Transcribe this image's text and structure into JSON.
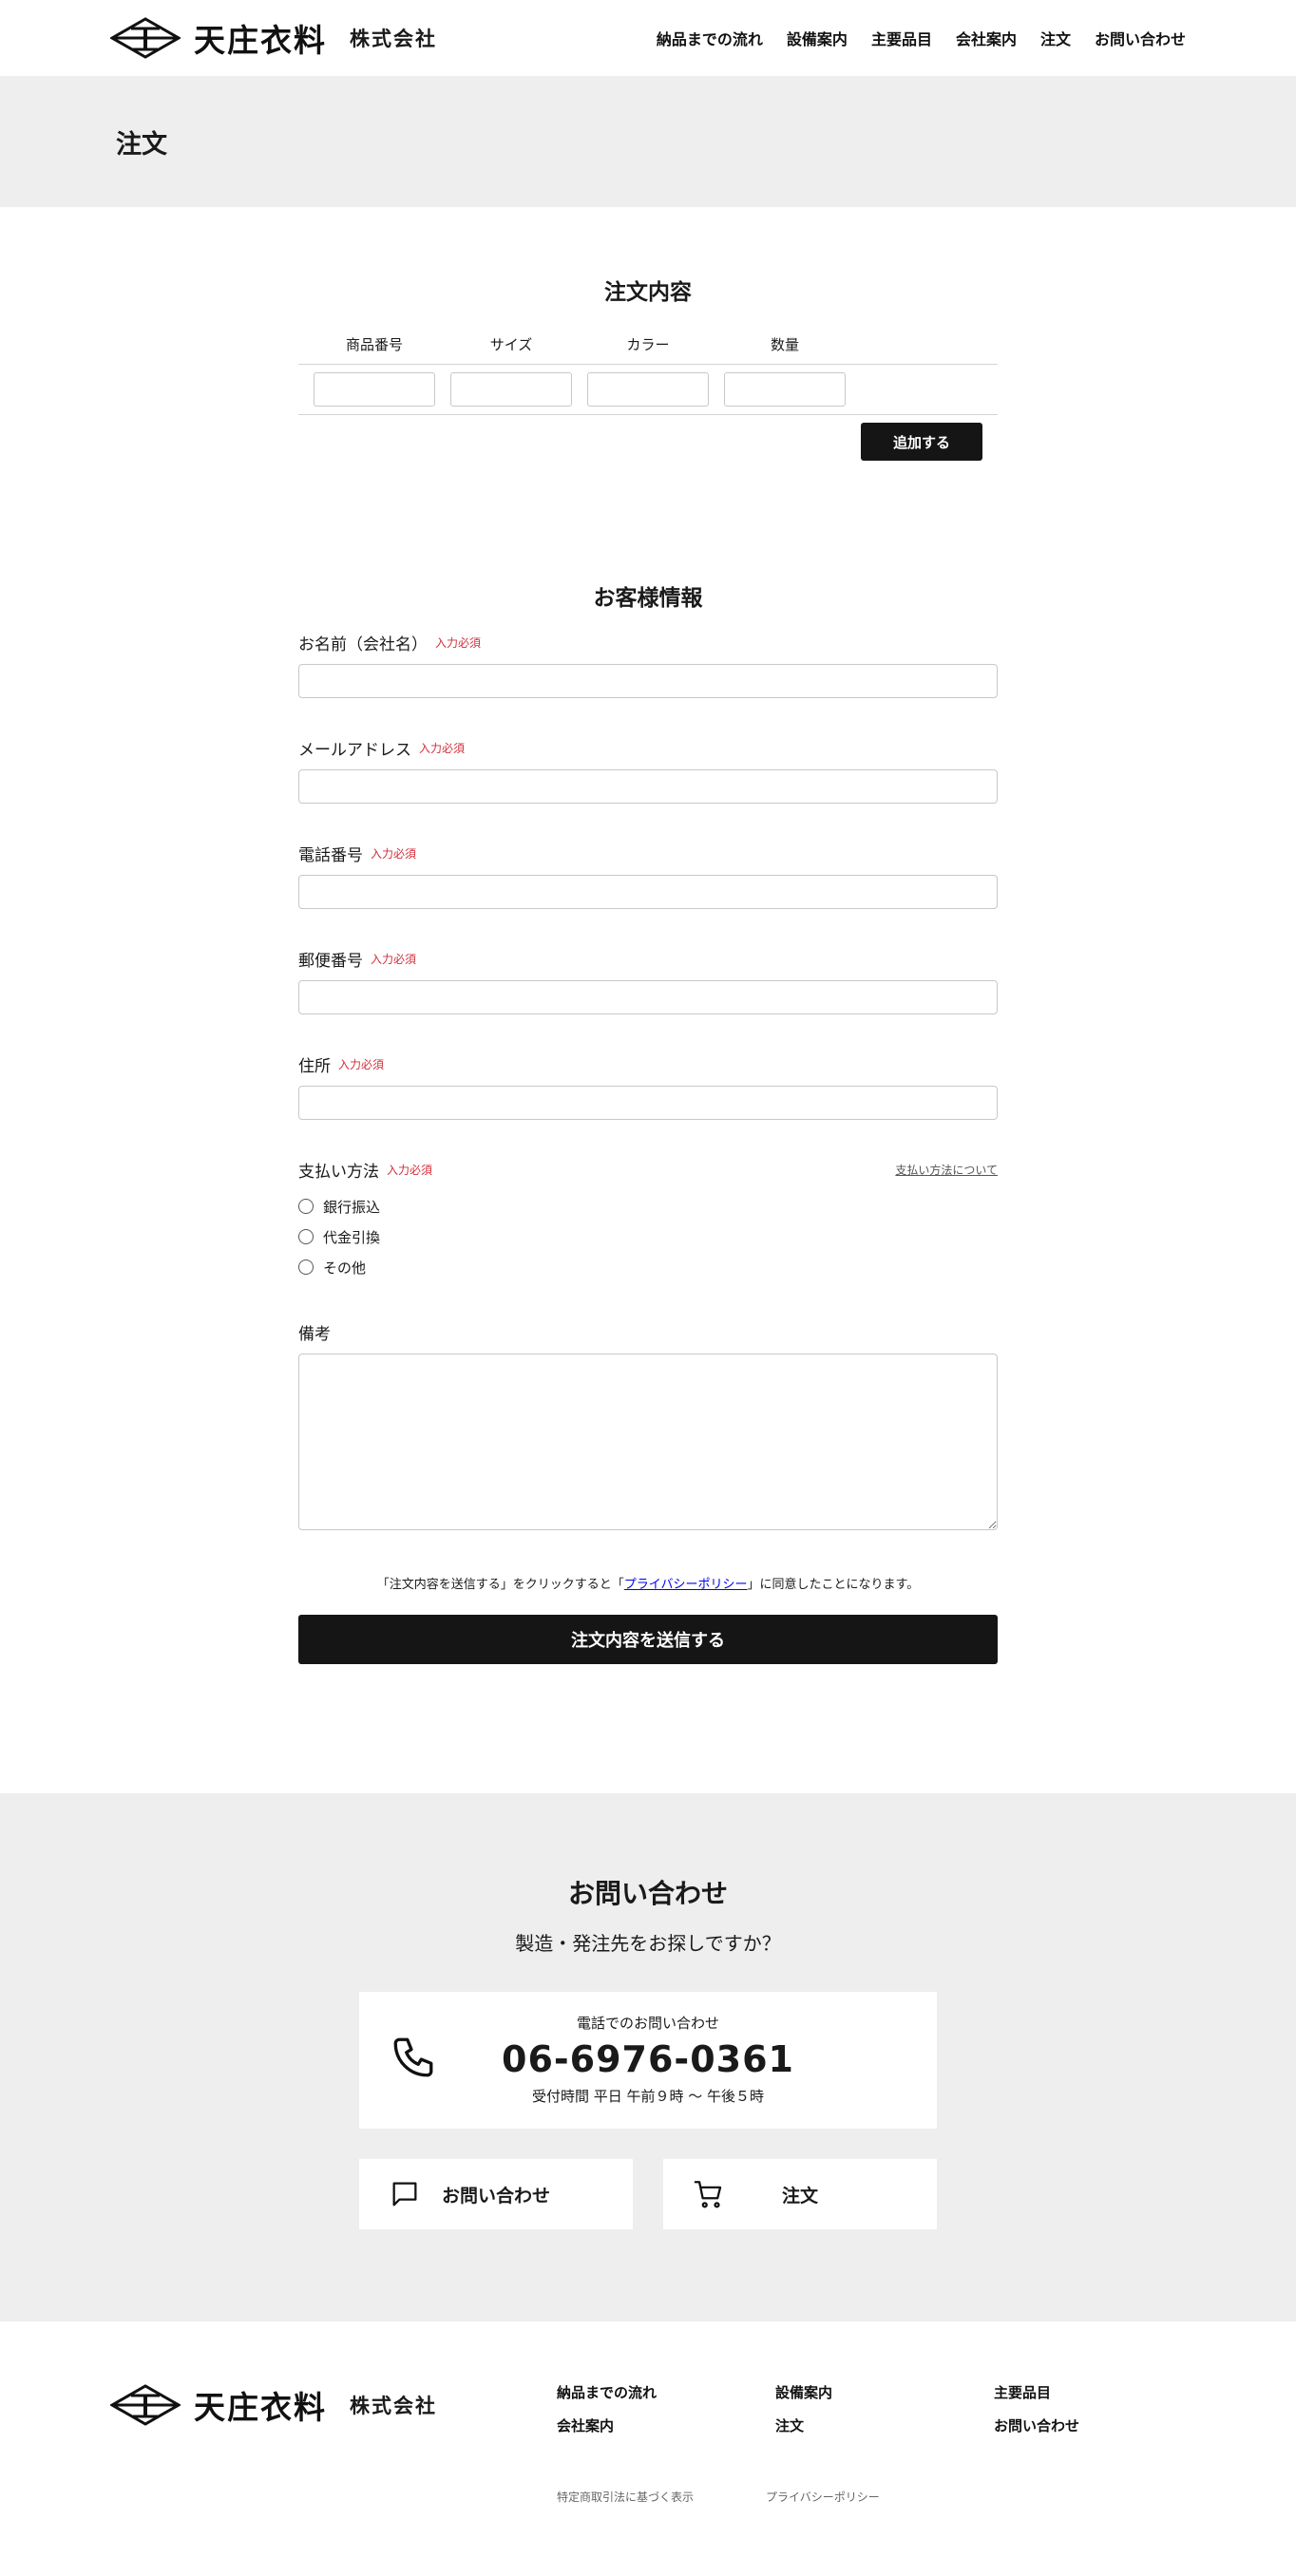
{
  "header": {
    "logo_text": "天庄衣料",
    "logo_sub": "株式会社",
    "nav": [
      "納品までの流れ",
      "設備案内",
      "主要品目",
      "会社案内",
      "注文",
      "お問い合わせ"
    ]
  },
  "page_title": "注文",
  "order": {
    "title": "注文内容",
    "columns": [
      "商品番号",
      "サイズ",
      "カラー",
      "数量"
    ],
    "add_button": "追加する"
  },
  "customer": {
    "title": "お客様情報",
    "required_badge": "入力必須",
    "fields": {
      "name": "お名前（会社名）",
      "email": "メールアドレス",
      "phone": "電話番号",
      "postal": "郵便番号",
      "address": "住所"
    },
    "payment": {
      "label": "支払い方法",
      "link": "支払い方法について",
      "options": [
        "銀行振込",
        "代金引換",
        "その他"
      ]
    },
    "notes_label": "備考",
    "consent_prefix": "「注文内容を送信する」をクリックすると「",
    "consent_link": "プライバシーポリシー",
    "consent_suffix": "」に同意したことになります。",
    "submit_button": "注文内容を送信する"
  },
  "contact": {
    "title": "お問い合わせ",
    "lead": "製造・発注先をお探しですか？",
    "phone_label": "電話でのお問い合わせ",
    "phone_number": "06-6976-0361",
    "phone_hours": "受付時間  平日 午前９時 〜 午後５時",
    "inquiry_button": "お問い合わせ",
    "order_button": "注文"
  },
  "footer": {
    "nav": [
      "納品までの流れ",
      "設備案内",
      "主要品目",
      "会社案内",
      "注文",
      "お問い合わせ"
    ],
    "legal": [
      "特定商取引法に基づく表示",
      "プライバシーポリシー"
    ]
  },
  "icons": {
    "logo": "logo-mark-icon",
    "phone": "phone-icon",
    "chat": "chat-bubble-icon",
    "cart": "cart-icon"
  }
}
